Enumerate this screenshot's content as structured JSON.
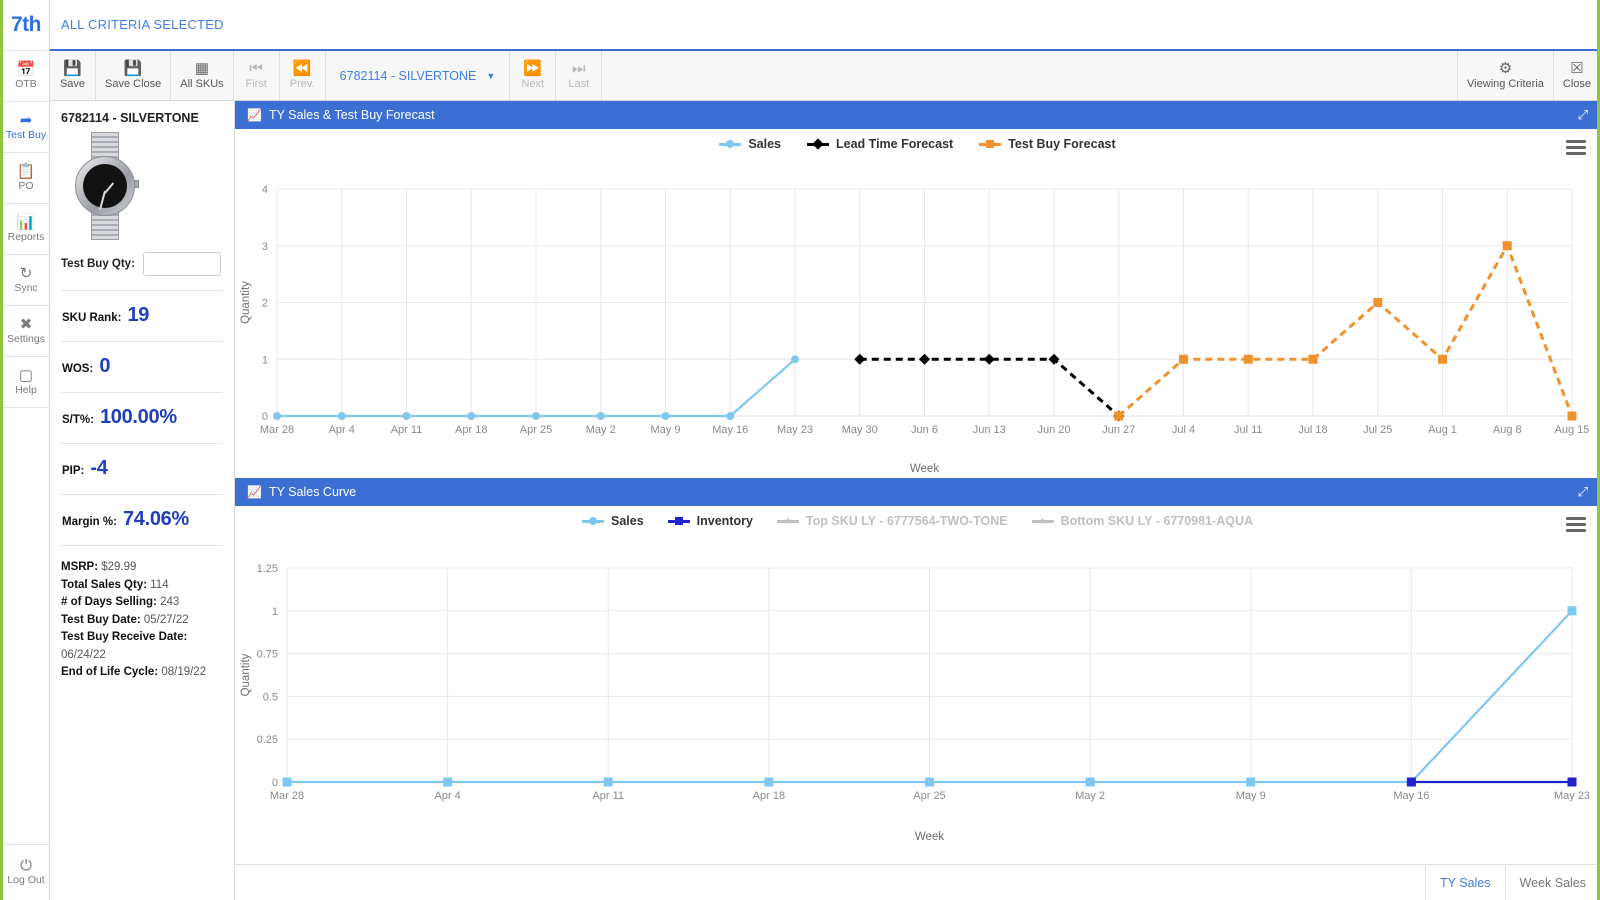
{
  "brand": {
    "logo": "7th",
    "criteria_banner": "ALL CRITERIA SELECTED"
  },
  "rail": {
    "items": [
      {
        "label": "OTB",
        "icon": "calendar-dollar-icon"
      },
      {
        "label": "Test Buy",
        "icon": "arrow-curve-icon"
      },
      {
        "label": "PO",
        "icon": "clipboard-icon"
      },
      {
        "label": "Reports",
        "icon": "bar-chart-icon"
      },
      {
        "label": "Sync",
        "icon": "refresh-icon"
      },
      {
        "label": "Settings",
        "icon": "tools-icon"
      },
      {
        "label": "Help",
        "icon": "question-icon"
      }
    ],
    "logout": {
      "label": "Log Out",
      "icon": "power-icon"
    }
  },
  "toolbar": {
    "save": "Save",
    "save_close": "Save Close",
    "all_skus": "All SKUs",
    "first": "First",
    "prev": "Prev.",
    "sku_select": "6782114 - SILVERTONE",
    "next": "Next",
    "last": "Last",
    "viewing_criteria": "Viewing Criteria",
    "close": "Close"
  },
  "detail": {
    "sku_title": "6782114 - SILVERTONE",
    "test_buy_qty_label": "Test Buy Qty:",
    "test_buy_qty_value": "",
    "test_buy_qty_placeholder": "",
    "stats": [
      {
        "key": "SKU Rank:",
        "value": "19"
      },
      {
        "key": "WOS:",
        "value": "0"
      },
      {
        "key": "S/T%:",
        "value": "100.00%"
      },
      {
        "key": "PIP:",
        "value": "-4"
      },
      {
        "key": "Margin %:",
        "value": "74.06%"
      }
    ],
    "meta": [
      {
        "key": "MSRP:",
        "value": "$29.99"
      },
      {
        "key": "Total Sales Qty:",
        "value": "114"
      },
      {
        "key": "# of Days Selling:",
        "value": "243"
      },
      {
        "key": "Test Buy Date:",
        "value": "05/27/22"
      },
      {
        "key": "Test Buy Receive Date:",
        "value": "06/24/22"
      },
      {
        "key": "End of Life Cycle:",
        "value": "08/19/22"
      }
    ]
  },
  "panels": {
    "forecast_title": "TY Sales & Test Buy Forecast",
    "curve_title": "TY Sales Curve"
  },
  "tabs": [
    {
      "label": "TY Sales",
      "active": true
    },
    {
      "label": "Week Sales",
      "active": false
    }
  ],
  "colors": {
    "sales": "#7ec8ef",
    "lead_time_forecast": "#000000",
    "test_buy_forecast": "#f0912d",
    "inventory": "#2222cc",
    "disabled": "#bfbfbf",
    "accent": "#3b6fd4",
    "brand_green": "#8dc63f"
  },
  "chart_data": [
    {
      "type": "line",
      "title": "TY Sales & Test Buy Forecast",
      "xlabel": "Week",
      "ylabel": "Quantity",
      "ylim": [
        0,
        4
      ],
      "yticks": [
        0,
        1,
        2,
        3,
        4
      ],
      "grid": true,
      "legend_position": "top-center",
      "categories": [
        "Mar 28",
        "Apr 4",
        "Apr 11",
        "Apr 18",
        "Apr 25",
        "May 2",
        "May 9",
        "May 16",
        "May 23",
        "May 30",
        "Jun 6",
        "Jun 13",
        "Jun 20",
        "Jun 27",
        "Jul 4",
        "Jul 11",
        "Jul 18",
        "Jul 25",
        "Aug 1",
        "Aug 8",
        "Aug 15"
      ],
      "series": [
        {
          "name": "Sales",
          "color": "#7ec8ef",
          "style": "solid",
          "marker": "circle",
          "values": [
            0,
            0,
            0,
            0,
            0,
            0,
            0,
            0,
            1,
            null,
            null,
            null,
            null,
            null,
            null,
            null,
            null,
            null,
            null,
            null,
            null
          ]
        },
        {
          "name": "Lead Time Forecast",
          "color": "#000000",
          "style": "dashed",
          "marker": "diamond",
          "values": [
            null,
            null,
            null,
            null,
            null,
            null,
            null,
            null,
            null,
            1,
            1,
            1,
            1,
            0,
            null,
            null,
            null,
            null,
            null,
            null,
            null
          ]
        },
        {
          "name": "Test Buy Forecast",
          "color": "#f0912d",
          "style": "dashed",
          "marker": "square",
          "values": [
            null,
            null,
            null,
            null,
            null,
            null,
            null,
            null,
            null,
            null,
            null,
            null,
            null,
            0,
            1,
            1,
            1,
            2,
            1,
            3,
            0
          ]
        }
      ]
    },
    {
      "type": "line",
      "title": "TY Sales Curve",
      "xlabel": "Week",
      "ylabel": "Quantity",
      "ylim": [
        0,
        1.25
      ],
      "yticks": [
        0,
        0.25,
        0.5,
        0.75,
        1,
        1.25
      ],
      "ytick_labels": [
        "0",
        "0.25",
        "0.5",
        "0.75",
        "1",
        "1.25"
      ],
      "grid": true,
      "legend_position": "top-center",
      "categories": [
        "Mar 28",
        "Apr 4",
        "Apr 11",
        "Apr 18",
        "Apr 25",
        "May 2",
        "May 9",
        "May 16",
        "May 23"
      ],
      "series": [
        {
          "name": "Sales",
          "color": "#7ec8ef",
          "style": "solid",
          "marker": "square",
          "enabled": true,
          "values": [
            0,
            0,
            0,
            0,
            0,
            0,
            0,
            0,
            1
          ]
        },
        {
          "name": "Inventory",
          "color": "#2222cc",
          "style": "solid",
          "marker": "square",
          "enabled": true,
          "values": [
            null,
            null,
            null,
            null,
            null,
            null,
            null,
            0,
            0
          ]
        },
        {
          "name": "Top SKU LY - 6777564-TWO-TONE",
          "color": "#bfbfbf",
          "style": "solid",
          "marker": "star",
          "enabled": false,
          "values": [
            null,
            null,
            null,
            null,
            null,
            null,
            null,
            null,
            null
          ]
        },
        {
          "name": "Bottom SKU LY - 6770981-AQUA",
          "color": "#bfbfbf",
          "style": "solid",
          "marker": "star",
          "enabled": false,
          "values": [
            null,
            null,
            null,
            null,
            null,
            null,
            null,
            null,
            null
          ]
        }
      ]
    }
  ]
}
